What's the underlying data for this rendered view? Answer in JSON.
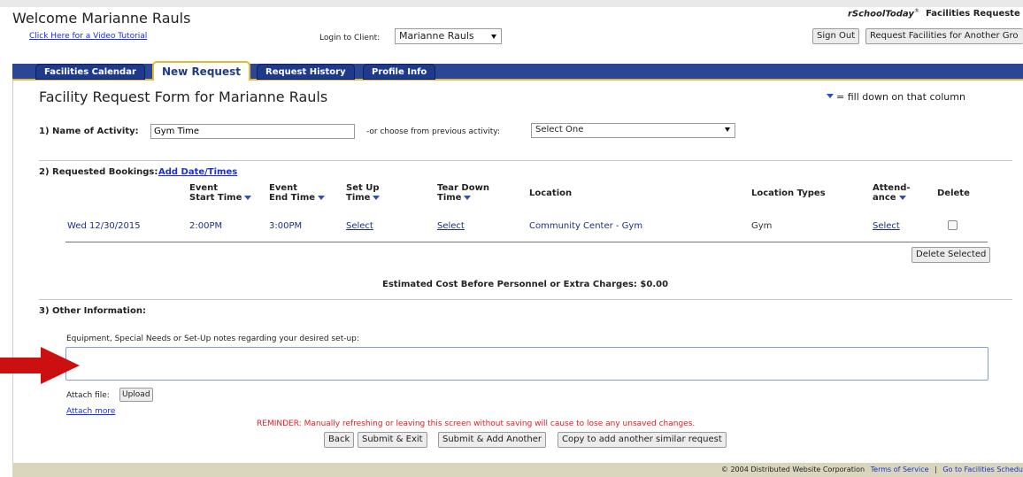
{
  "header": {
    "welcome": "Welcome Marianne Rauls",
    "video_link": "Click Here for a Video Tutorial",
    "login_label": "Login to Client:",
    "login_value": "Marianne Rauls",
    "brand_name": "rSchoolToday",
    "brand_suffix": "Facilities Requeste",
    "sign_out": "Sign Out",
    "request_another": "Request Facilities for Another Gro"
  },
  "tabs": [
    {
      "label": "Facilities Calendar"
    },
    {
      "label": "New Request"
    },
    {
      "label": "Request History"
    },
    {
      "label": "Profile Info"
    }
  ],
  "form": {
    "title": "Facility Request Form for Marianne Rauls",
    "filldown_note": "= fill down on that column",
    "activity_label": "1) Name of Activity:",
    "activity_value": "Gym Time",
    "previous_label": "-or choose from previous activity:",
    "previous_value": "Select One",
    "bookings_label": "2) Requested Bookings:",
    "add_dates": "Add Date/Times"
  },
  "table": {
    "headers": {
      "start1": "Event",
      "start2": "Start Time",
      "end1": "Event",
      "end2": "End Time",
      "setup1": "Set Up",
      "setup2": "Time",
      "teardown1": "Tear Down",
      "teardown2": "Time",
      "location": "Location",
      "location_types": "Location Types",
      "attend1": "Attend-",
      "attend2": "ance",
      "delete": "Delete"
    },
    "row": {
      "date": "Wed 12/30/2015",
      "start": "2:00PM",
      "end": "3:00PM",
      "setup": "Select",
      "teardown": "Select",
      "location": "Community Center - Gym",
      "location_type": "Gym",
      "attendance": "Select"
    },
    "delete_selected": "Delete Selected",
    "estimated_cost": "Estimated Cost Before Personnel or Extra Charges: $0.00"
  },
  "other": {
    "label": "3) Other Information:",
    "notes_label": "Equipment, Special Needs or Set-Up notes regarding your desired set-up:",
    "notes_value": "",
    "attach_label": "Attach file:",
    "upload": "Upload",
    "attach_more": "Attach more",
    "reminder": "REMINDER: Manually refreshing or leaving this screen without saving will cause to lose any unsaved changes."
  },
  "actions": {
    "back": "Back",
    "submit_exit": "Submit & Exit",
    "submit_add": "Submit & Add Another",
    "copy": "Copy to add another similar request"
  },
  "footer": {
    "copyright": "© 2004 Distributed Website Corporation",
    "terms": "Terms of Service",
    "separator": "|",
    "goto": "Go to Facilities Schedu"
  },
  "colors": {
    "tab_bar": "#2a4694",
    "reminder": "#e02020",
    "arrow": "#cc1010",
    "footer_bar": "#d9d6bd"
  }
}
